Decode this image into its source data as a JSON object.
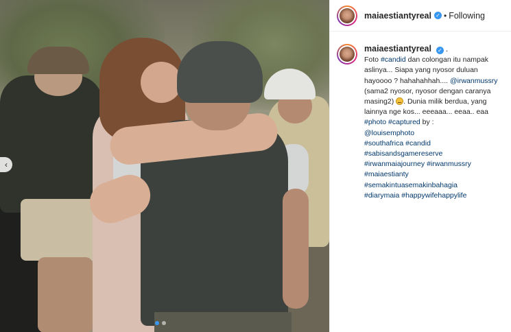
{
  "header": {
    "username": "maiaestiantyreal",
    "verified_icon": "verified-badge-icon",
    "separator": "•",
    "follow_status": "Following"
  },
  "photo": {
    "prev_icon": "chevron-left-icon",
    "prev_glyph": "‹",
    "carousel_dots": 2,
    "carousel_active_index": 0
  },
  "caption": {
    "username": "maiaestiantyreal",
    "trailing": ".",
    "line1_before": "Foto ",
    "tag_candid": "#candid",
    "line1_after": " dan colongan itu nampak aslinya... Siapa yang nyosor duluan hayoooo ? hahahahhah.... ",
    "mention_irwan": "@irwanmussry",
    "mention_after": " (sama2 nyosor, nyosor dengan caranya masing2) ",
    "emoji_name": "grin-emoji-icon",
    "text_after_emoji": ". Dunia milik berdua, yang lainnya nge kos... eeeaaa... eeaa.. eaa",
    "tag_photo": "#photo",
    "tag_captured": "#captured",
    "captured_by": " by :",
    "mention_louise": "@louisemphoto",
    "tag_southafrica": "#southafrica",
    "tag_candid2": "#candid",
    "tag_sabisands": "#sabisandsgamereserve",
    "tag_journey": "#irwanmaiajourney",
    "tag_irwanmussry": "#irwanmussry",
    "tag_maiaestianty": "#maiaestianty",
    "tag_semakin": "#semakintuasemakinbahagia",
    "tag_diarymaia": "#diarymaia",
    "tag_happywife": "#happywifehappylife"
  },
  "colors": {
    "link": "#00376b",
    "verified": "#3897f0",
    "text": "#262626"
  }
}
